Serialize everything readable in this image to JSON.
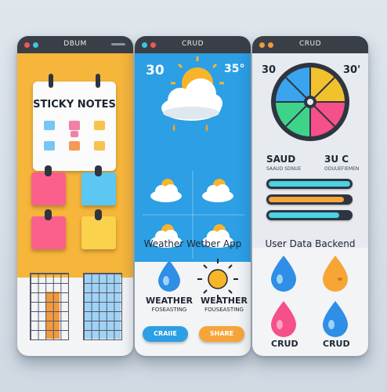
{
  "panels": {
    "sticky": {
      "title": "DBUM",
      "heading": "STICKY NOTES"
    },
    "weather": {
      "title": "CRUD",
      "temp_left": "30",
      "temp_right": "35°",
      "app_title": "Weather Wetber App",
      "label_left": "WEATHER",
      "sub_left": "FOSEASTING",
      "label_right": "WEATHER",
      "sub_right": "FOUSEASTING",
      "button_left": "CRAIIE",
      "button_right": "SHARE"
    },
    "backend": {
      "title": "CRUD",
      "value_left": "30",
      "value_right": "30'",
      "stat_left": "SAUD",
      "stat_left_sub": "SAAUD SDNUE",
      "stat_right": "3U C",
      "stat_right_sub": "ODUUEFIEMEN",
      "app_title": "User Data Backend",
      "crud_left": "CRUD",
      "crud_right": "CRUD"
    }
  },
  "colors": {
    "sticky_bg": "#f6b53b",
    "weather_bg": "#2c9fe5",
    "titlebar": "#3a3f47",
    "dot_red": "#f0565a",
    "dot_cyan": "#3cc6e2",
    "dot_orange": "#f29a3a",
    "note_pink": "#fb5f8c",
    "note_blue": "#5bc7f2",
    "note_yellow": "#fbd24c",
    "drop_blue": "#2f8ee6",
    "drop_orange": "#f7a534",
    "drop_pink": "#f5508a"
  }
}
